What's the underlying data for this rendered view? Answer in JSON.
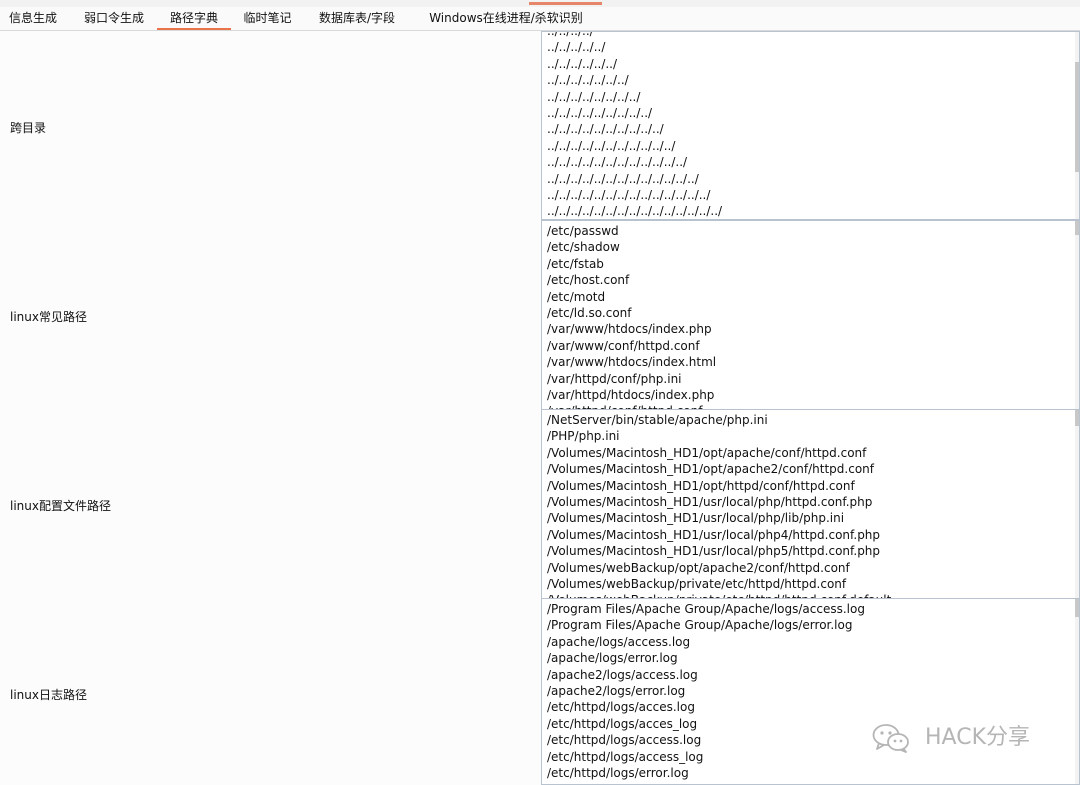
{
  "tabs": [
    {
      "label": "信息生成",
      "active": false
    },
    {
      "label": "弱口令生成",
      "active": false
    },
    {
      "label": "路径字典",
      "active": true
    },
    {
      "label": "临时笔记",
      "active": false
    },
    {
      "label": "数据库表/字段",
      "active": false
    },
    {
      "label": "Windows在线进程/杀软识别",
      "active": false
    }
  ],
  "rows": [
    {
      "label": "跨目录",
      "text": "../../../../\n../../../../../\n../../../../../../\n../../../../../../../\n../../../../../../../../\n../../../../../../../../../\n../../../../../../../../../../\n../../../../../../../../../../../\n../../../../../../../../../../../../\n../../../../../../../../../../../../../\n../../../../../../../../../../../../../../\n../../../../../../../../../../../../../../../"
    },
    {
      "label": "linux常见路径",
      "text": "/etc/passwd\n/etc/shadow\n/etc/fstab\n/etc/host.conf\n/etc/motd\n/etc/ld.so.conf\n/var/www/htdocs/index.php\n/var/www/conf/httpd.conf\n/var/www/htdocs/index.html\n/var/httpd/conf/php.ini\n/var/httpd/htdocs/index.php\n/var/httpd/conf/httpd.conf"
    },
    {
      "label": "linux配置文件路径",
      "text": "/NetServer/bin/stable/apache/php.ini\n/PHP/php.ini\n/Volumes/Macintosh_HD1/opt/apache/conf/httpd.conf\n/Volumes/Macintosh_HD1/opt/apache2/conf/httpd.conf\n/Volumes/Macintosh_HD1/opt/httpd/conf/httpd.conf\n/Volumes/Macintosh_HD1/usr/local/php/httpd.conf.php\n/Volumes/Macintosh_HD1/usr/local/php/lib/php.ini\n/Volumes/Macintosh_HD1/usr/local/php4/httpd.conf.php\n/Volumes/Macintosh_HD1/usr/local/php5/httpd.conf.php\n/Volumes/webBackup/opt/apache2/conf/httpd.conf\n/Volumes/webBackup/private/etc/httpd/httpd.conf\n/Volumes/webBackup/private/etc/httpd/httpd.conf.default"
    },
    {
      "label": "linux日志路径",
      "text": "/Program Files/Apache Group/Apache/logs/access.log\n/Program Files/Apache Group/Apache/logs/error.log\n/apache/logs/access.log\n/apache/logs/error.log\n/apache2/logs/access.log\n/apache2/logs/error.log\n/etc/httpd/logs/acces.log\n/etc/httpd/logs/acces_log\n/etc/httpd/logs/access.log\n/etc/httpd/logs/access_log\n/etc/httpd/logs/error.log"
    }
  ],
  "watermark": {
    "text": "HACK分享",
    "icon": "wechat-icon"
  }
}
